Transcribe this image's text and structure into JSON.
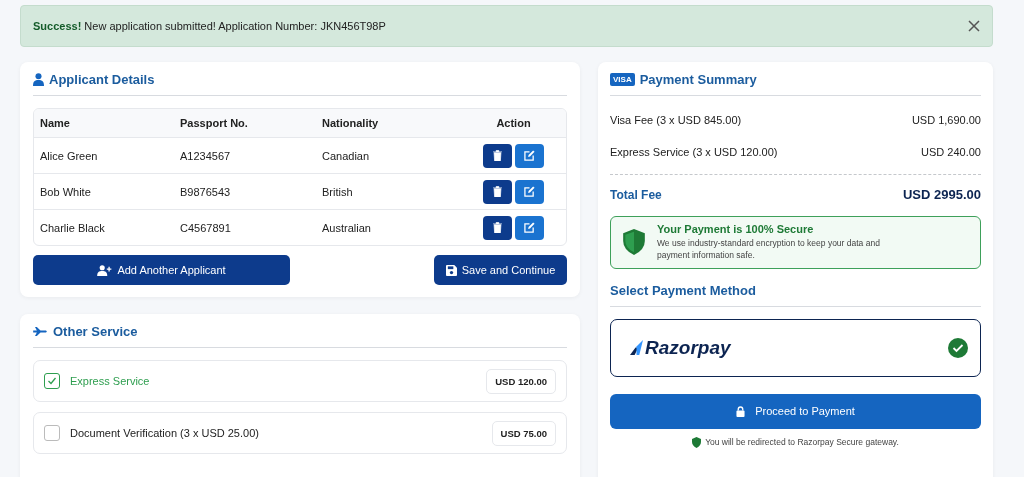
{
  "alert": {
    "title": "Success!",
    "message": "New application submitted! Application Number: JKN456T98P"
  },
  "applicants": {
    "title": "Applicant Details",
    "columns": [
      "Name",
      "Passport No.",
      "Nationality",
      "Action"
    ],
    "rows": [
      {
        "name": "Alice Green",
        "passport": "A1234567",
        "nationality": "Canadian"
      },
      {
        "name": "Bob White",
        "passport": "B9876543",
        "nationality": "British"
      },
      {
        "name": "Charlie Black",
        "passport": "C4567891",
        "nationality": "Australian"
      }
    ],
    "add_button": "Add Another Applicant",
    "save_button": "Save and Continue"
  },
  "services": {
    "title": "Other Service",
    "items": [
      {
        "label": "Express Service",
        "price": "USD 120.00",
        "checked": true
      },
      {
        "label": "Document Verification (3 x USD 25.00)",
        "price": "USD 75.00",
        "checked": false
      }
    ]
  },
  "summary": {
    "title": "Payment Summary",
    "card_badge": "VISA",
    "lines": [
      {
        "label": "Visa Fee (3 x USD 845.00)",
        "amount": "USD 1,690.00"
      },
      {
        "label": "Express Service (3 x USD 120.00)",
        "amount": "USD 240.00"
      }
    ],
    "total_label": "Total Fee",
    "total_amount": "USD 2995.00",
    "secure": {
      "title": "Your Payment is 100% Secure",
      "text": "We use industry-standard encryption to keep your data and payment information safe."
    },
    "method_title": "Select Payment Method",
    "methods": [
      {
        "name": "Razorpay",
        "selected": true
      }
    ],
    "pay_button": "Proceed to Payment",
    "note": "You will be redirected to Razorpay Secure gateway."
  }
}
